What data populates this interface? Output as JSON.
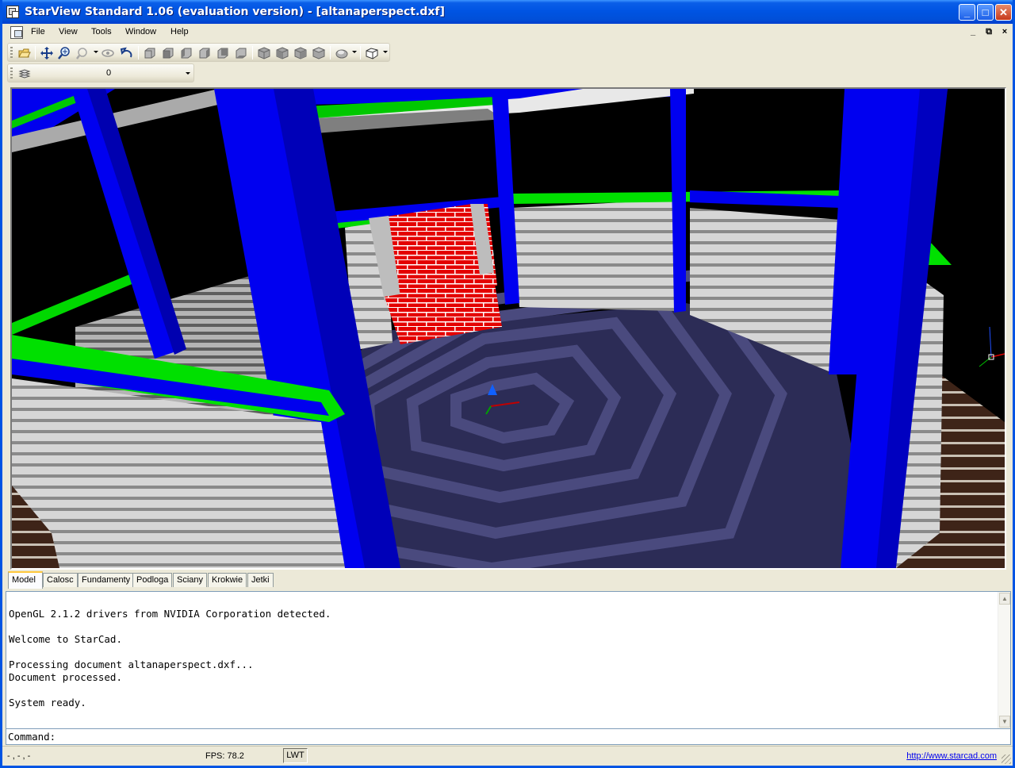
{
  "window": {
    "title": "StarView Standard 1.06 (evaluation version) - [altanaperspect.dxf]",
    "controls": {
      "minimize": "_",
      "maximize": "□",
      "close": "✕"
    }
  },
  "menubar": {
    "items": [
      "File",
      "View",
      "Tools",
      "Window",
      "Help"
    ],
    "mdi_controls": {
      "minimize": "_",
      "restore": "⧉",
      "close": "×"
    }
  },
  "toolbar": {
    "icons": [
      "open-icon",
      "pan-icon",
      "zoom-realtime-icon",
      "zoom-window-icon",
      "orbit-icon",
      "undo-view-icon",
      "view-top-icon",
      "view-front-icon",
      "view-left-icon",
      "view-right-icon",
      "view-back-icon",
      "iso-sw-icon",
      "iso-se-icon",
      "iso-ne-icon",
      "iso-nw-icon",
      "shading-icon",
      "projection-icon"
    ]
  },
  "layer_toolbar": {
    "current_layer": "0"
  },
  "tabs": [
    "Model",
    "Calosc",
    "Fundamenty",
    "Podloga",
    "Sciany",
    "Krokwie",
    "Jetki"
  ],
  "active_tab": "Model",
  "console": {
    "lines": [
      "",
      "OpenGL 2.1.2 drivers from NVIDIA Corporation detected.",
      "",
      "Welcome to StarCad.",
      "",
      "Processing document altanaperspect.dxf...",
      "Document processed.",
      "",
      "System ready."
    ]
  },
  "command": {
    "label": "Command:",
    "value": ""
  },
  "statusbar": {
    "coords": "- , - , -",
    "fps": "FPS: 78.2",
    "lwt": "LWT",
    "link": "http://www.starcad.com"
  },
  "colors": {
    "title_blue": "#0054e3",
    "beam_blue": "#0000e8",
    "rail_green": "#00e400",
    "brick_red": "#e00000",
    "floor_dark": "#2e2e58",
    "floor_light": "#4a4a7c"
  }
}
